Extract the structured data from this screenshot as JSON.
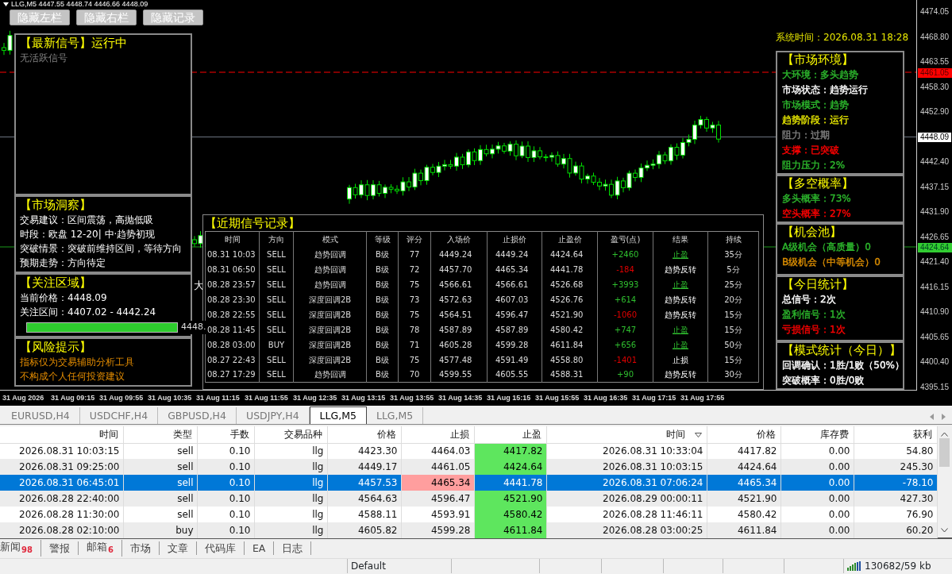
{
  "chart": {
    "title": "LLG,M5  4447.55 4448.74 4446.66 4448.09"
  },
  "toolbar_buttons": [
    "隐藏左栏",
    "隐藏右栏",
    "隐藏记录"
  ],
  "latest_signal": {
    "title": "【最新信号】运行中",
    "lines": [
      "无活跃信号"
    ]
  },
  "market_insight": {
    "title": "【市场洞察】",
    "lines": [
      "交易建议：区间震荡，高抛低吸",
      "时段：欧盘 12-20| 中·趋势初现",
      "突破情景：突破前维持区间，等待方向",
      "预期走势：方向待定"
    ]
  },
  "focus_zone": {
    "title": "【关注区域】",
    "lines": [
      "当前价格：4448.09",
      "关注区间：4407.02 - 4442.24"
    ],
    "meter": {
      "level": 1,
      "reading": "4448."
    }
  },
  "risk_notice": {
    "title": "【风险提示】",
    "lines": [
      "指标仅为交易辅助分析工具",
      "不构成个人任何投资建议"
    ]
  },
  "side_mark": "大",
  "signal_records": {
    "title": "【近期信号记录】",
    "columns": [
      "时间",
      "方向",
      "模式",
      "等级",
      "评分",
      "入场价",
      "止损价",
      "止盈价",
      "盈亏(点)",
      "结果",
      "持续"
    ],
    "rows": [
      {
        "cells": [
          "08.31 10:03",
          "SELL",
          "趋势回调",
          "B级",
          "77",
          "4449.24",
          "4449.24",
          "4424.64",
          "+2460",
          "止盈",
          "35分"
        ],
        "profit": true,
        "take_profit": true
      },
      {
        "cells": [
          "08.31 06:50",
          "SELL",
          "趋势回调",
          "B级",
          "72",
          "4457.70",
          "4465.34",
          "4441.78",
          "-184",
          "趋势反转",
          "5分"
        ],
        "profit": false,
        "take_profit": false
      },
      {
        "cells": [
          "08.28 23:57",
          "SELL",
          "趋势回调",
          "B级",
          "75",
          "4566.61",
          "4566.61",
          "4526.68",
          "+3993",
          "止盈",
          "25分"
        ],
        "profit": true,
        "take_profit": true
      },
      {
        "cells": [
          "08.28 23:30",
          "SELL",
          "深度回调2B",
          "B级",
          "73",
          "4572.63",
          "4607.03",
          "4526.76",
          "+614",
          "趋势反转",
          "20分"
        ],
        "profit": true,
        "take_profit": false
      },
      {
        "cells": [
          "08.28 22:55",
          "SELL",
          "深度回调2B",
          "B级",
          "75",
          "4564.51",
          "4596.47",
          "4521.90",
          "-1060",
          "趋势反转",
          "15分"
        ],
        "profit": false,
        "take_profit": false
      },
      {
        "cells": [
          "08.28 11:45",
          "SELL",
          "深度回调2B",
          "B级",
          "78",
          "4587.89",
          "4587.89",
          "4580.42",
          "+747",
          "止盈",
          "15分"
        ],
        "profit": true,
        "take_profit": true
      },
      {
        "cells": [
          "08.28 03:00",
          "BUY",
          "深度回调2B",
          "B级",
          "71",
          "4605.28",
          "4599.28",
          "4611.84",
          "+656",
          "止盈",
          "50分"
        ],
        "profit": true,
        "take_profit": true
      },
      {
        "cells": [
          "08.27 22:43",
          "SELL",
          "深度回调2B",
          "B级",
          "75",
          "4577.48",
          "4591.49",
          "4558.80",
          "-1401",
          "止损",
          "15分"
        ],
        "profit": false,
        "take_profit": false
      },
      {
        "cells": [
          "08.27 17:29",
          "SELL",
          "趋势回调",
          "B级",
          "70",
          "4599.55",
          "4605.55",
          "4588.31",
          "+90",
          "趋势反转",
          "30分"
        ],
        "profit": true,
        "take_profit": false
      }
    ]
  },
  "system_time": "系统时间：2026.08.31 18:28",
  "right_panels": [
    {
      "title": "【市场环境】",
      "lines": [
        {
          "text": "大环境：多头趋势",
          "color": "#2db82d"
        },
        {
          "text": "市场状态：趋势运行",
          "color": "#ffffff"
        },
        {
          "text": "市场模式：趋势",
          "color": "#2db82d"
        },
        {
          "text": "趋势阶段：运行",
          "color": "#e6e600"
        },
        {
          "text": "阻力：过期",
          "color": "#808080"
        },
        {
          "text": "支撑：已突破",
          "color": "#ff0000"
        },
        {
          "text": "阻力压力：2%",
          "color": "#2db82d"
        }
      ]
    },
    {
      "title": "【多空概率】",
      "lines": [
        {
          "text": "多头概率：73%",
          "color": "#2db82d"
        },
        {
          "text": "空头概率：27%",
          "color": "#ff0000"
        }
      ]
    },
    {
      "title": "【机会池】",
      "lines": [
        {
          "text": "A级机会（高质量）0",
          "color": "#2db82d"
        },
        {
          "text": "B级机会（中等机会）0",
          "color": "#d98c00"
        }
      ]
    },
    {
      "title": "【今日统计】",
      "lines": [
        {
          "text": "总信号：2次",
          "color": "#ffffff"
        },
        {
          "text": "盈利信号：1次",
          "color": "#2db82d"
        },
        {
          "text": "亏损信号：1次",
          "color": "#ff0000"
        }
      ]
    },
    {
      "title": "【模式统计（今日）】",
      "lines": [
        {
          "text": "回调确认：1胜/1败（50%）",
          "color": "#ffffff"
        },
        {
          "text": "突破概率：0胜/0败",
          "color": "#ffffff"
        }
      ]
    }
  ],
  "price_axis": [
    {
      "text": "4474.05",
      "kind": "tick"
    },
    {
      "text": "4468.80",
      "kind": "tick"
    },
    {
      "text": "4463.55",
      "kind": "tick"
    },
    {
      "text": "4458.30",
      "kind": "tick"
    },
    {
      "text": "4452.90",
      "kind": "tick"
    },
    {
      "text": "4448.09",
      "kind": "bid"
    },
    {
      "text": "4442.40",
      "kind": "tick"
    },
    {
      "text": "4437.15",
      "kind": "tick"
    },
    {
      "text": "4431.90",
      "kind": "tick"
    },
    {
      "text": "4426.65",
      "kind": "tick"
    },
    {
      "text": "4421.40",
      "kind": "tick"
    },
    {
      "text": "4416.15",
      "kind": "tick"
    },
    {
      "text": "4410.90",
      "kind": "tick"
    },
    {
      "text": "4405.65",
      "kind": "tick"
    },
    {
      "text": "4400.40",
      "kind": "tick"
    },
    {
      "text": "4395.15",
      "kind": "tick"
    }
  ],
  "price_tags": [
    {
      "text": "4461.05",
      "kind": "stop_loss"
    },
    {
      "text": "4424.64",
      "kind": "take_profit"
    }
  ],
  "time_axis": [
    "31 Aug 2026",
    "31 Aug 09:15",
    "31 Aug 09:55",
    "31 Aug 10:35",
    "31 Aug 11:15",
    "31 Aug 11:55",
    "31 Aug 12:35",
    "31 Aug 13:15",
    "31 Aug 13:55",
    "31 Aug 14:35",
    "31 Aug 15:15",
    "31 Aug 15:55",
    "31 Aug 16:35",
    "31 Aug 17:15",
    "31 Aug 17:55"
  ],
  "chart_tabs": [
    {
      "label": "EURUSD,H4",
      "selected": false
    },
    {
      "label": "USDCHF,H4",
      "selected": false
    },
    {
      "label": "GBPUSD,H4",
      "selected": false
    },
    {
      "label": "USDJPY,H4",
      "selected": false
    },
    {
      "label": "LLG,M5",
      "selected": true
    },
    {
      "label": "LLG,M5",
      "selected": false
    }
  ],
  "trade_table": {
    "columns": [
      {
        "label": "时间",
        "sorted": false
      },
      {
        "label": "类型",
        "sorted": false
      },
      {
        "label": "手数",
        "sorted": false
      },
      {
        "label": "交易品种",
        "sorted": false
      },
      {
        "label": "价格",
        "sorted": false
      },
      {
        "label": "止损",
        "sorted": false
      },
      {
        "label": "止盈",
        "sorted": false
      },
      {
        "label": "时间",
        "sorted": true
      },
      {
        "label": "价格",
        "sorted": false
      },
      {
        "label": "库存费",
        "sorted": false
      },
      {
        "label": "获利",
        "sorted": false
      }
    ],
    "rows": [
      {
        "cells": [
          "2026.08.31 10:03:15",
          "sell",
          "0.10",
          "llg",
          "4423.30",
          "4464.03",
          "4417.82",
          "2026.08.31 10:33:04",
          "4417.82",
          "0.00",
          "54.80"
        ],
        "selected": false,
        "sl_hit": false,
        "tp_hit": true
      },
      {
        "cells": [
          "2026.08.31 09:25:00",
          "sell",
          "0.10",
          "llg",
          "4449.17",
          "4461.05",
          "4424.64",
          "2026.08.31 10:03:15",
          "4424.64",
          "0.00",
          "245.30"
        ],
        "selected": false,
        "sl_hit": false,
        "tp_hit": true
      },
      {
        "cells": [
          "2026.08.31 06:45:01",
          "sell",
          "0.10",
          "llg",
          "4457.53",
          "4465.34",
          "4441.78",
          "2026.08.31 07:06:24",
          "4465.34",
          "0.00",
          "-78.10"
        ],
        "selected": true,
        "sl_hit": true,
        "tp_hit": false
      },
      {
        "cells": [
          "2026.08.28 22:40:00",
          "sell",
          "0.10",
          "llg",
          "4564.63",
          "4596.47",
          "4521.90",
          "2026.08.29 00:00:11",
          "4521.90",
          "0.00",
          "427.30"
        ],
        "selected": false,
        "sl_hit": false,
        "tp_hit": true
      },
      {
        "cells": [
          "2026.08.28 11:30:00",
          "sell",
          "0.10",
          "llg",
          "4588.11",
          "4593.91",
          "4580.42",
          "2026.08.28 11:46:11",
          "4580.42",
          "0.00",
          "76.90"
        ],
        "selected": false,
        "sl_hit": false,
        "tp_hit": true
      },
      {
        "cells": [
          "2026.08.28 02:10:00",
          "buy",
          "0.10",
          "llg",
          "4605.82",
          "4599.28",
          "4611.84",
          "2026.08.28 03:00:25",
          "4611.84",
          "0.00",
          "60.20"
        ],
        "selected": false,
        "sl_hit": false,
        "tp_hit": true
      }
    ]
  },
  "terminal_tabs": [
    {
      "label": "新闻",
      "badge": "98"
    },
    {
      "label": "警报"
    },
    {
      "label": "邮箱",
      "badge": "6"
    },
    {
      "label": "市场"
    },
    {
      "label": "文章"
    },
    {
      "label": "代码库"
    },
    {
      "label": "EA"
    },
    {
      "label": "日志"
    }
  ],
  "status_bar": {
    "profile": "Default",
    "traffic": "130682/59 kb"
  }
}
